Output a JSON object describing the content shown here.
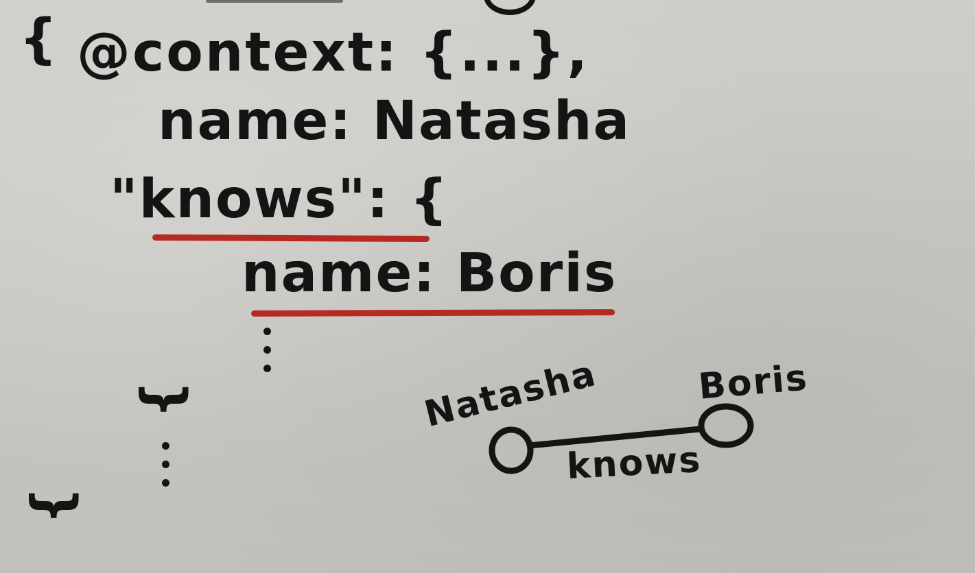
{
  "code": {
    "open_brace": "{",
    "line1": "@context: {...},",
    "line2": "name: Natasha",
    "line3": "\"knows\": {",
    "line4": "name: Boris",
    "inner_close": "}",
    "outer_close": "}"
  },
  "graph": {
    "node_left_label": "Natasha",
    "node_right_label": "Boris",
    "edge_label": "knows"
  },
  "colors": {
    "ink": "#141414",
    "underline": "#b52a22",
    "board": "#c9c7c2"
  }
}
